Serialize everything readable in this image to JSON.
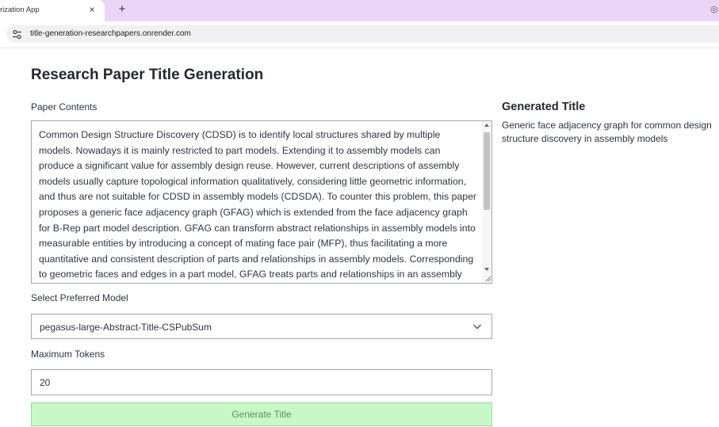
{
  "browser": {
    "tab_title": "rization App",
    "tab_close_glyph": "×",
    "new_tab_glyph": "+",
    "url": "title-generation-researchpapers.onrender.com"
  },
  "page": {
    "title": "Research Paper Title Generation",
    "contents_label": "Paper Contents",
    "contents_value": "Common Design Structure Discovery (CDSD) is to identify local structures shared by multiple models. Nowadays it is mainly restricted to part models. Extending it to assembly models can produce a significant value for assembly design reuse. However, current descriptions of assembly models usually capture topological information qualitatively, considering little geometric information, and thus are not suitable for CDSD in assembly models (CDSDA). To counter this problem, this paper proposes a generic face adjacency graph (GFAG) which is extended from the face adjacency graph for B-Rep part model description. GFAG can transform abstract relationships in assembly models into measurable entities by introducing a concept of mating face pair (MFP), thus facilitating a more quantitative and consistent description of parts and relationships in assembly models. Corresponding to geometric faces and edges in a part model, GFAG treats parts and relationships in an assembly model as nodes and arcs. Furthermore, a graph similarity-based algorithm is presented for CDSDA.",
    "model_label": "Select Preferred Model",
    "model_selected": "pegasus-large-Abstract-Title-CSPubSum",
    "tokens_label": "Maximum Tokens",
    "tokens_value": "20",
    "button_label": "Generate Title"
  },
  "output": {
    "heading": "Generated Title",
    "text": "Generic face adjacency graph for common design structure discovery in assembly models"
  },
  "colors": {
    "tab_strip": "#e9d6f7",
    "button_bg": "#c8f7c8",
    "button_text": "#5f8f5f"
  },
  "icons": {
    "site_info": "tune-icon",
    "dropdown": "chevron-down-icon"
  }
}
